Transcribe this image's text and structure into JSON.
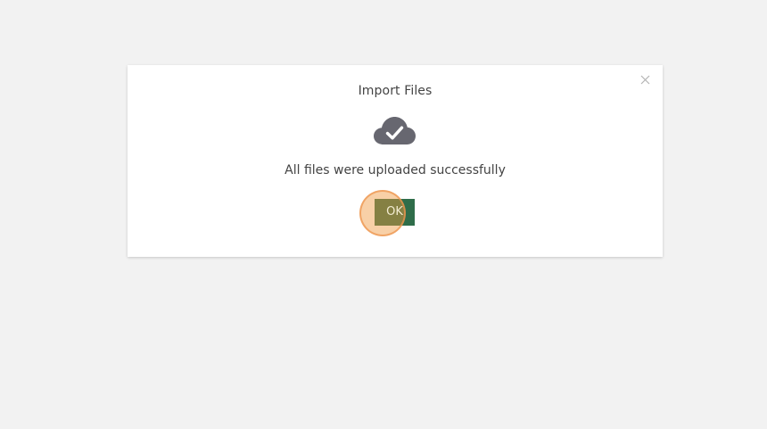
{
  "dialog": {
    "title": "Import Files",
    "message": "All files were uploaded successfully",
    "ok_label": "OK",
    "close_label": "×",
    "status_icon": "cloud-check-icon"
  },
  "colors": {
    "background": "#f2f2f2",
    "dialog_background": "#ffffff",
    "ok_button": "#2f6d4a",
    "icon": "#676770",
    "click_highlight": "#f0963c"
  }
}
